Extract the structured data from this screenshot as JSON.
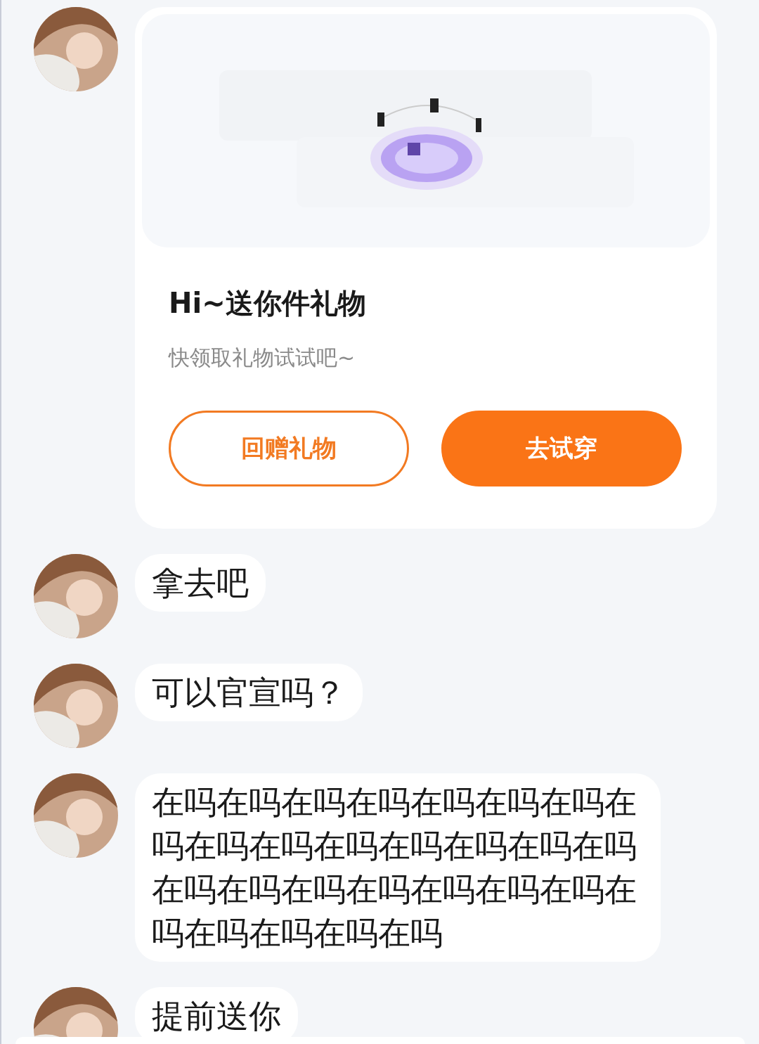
{
  "messages": [
    {
      "kind": "gift",
      "title": "Hi~送你件礼物",
      "subtitle": "快领取礼物试试吧~",
      "buttons": [
        {
          "label": "回赠礼物",
          "kind": "outline"
        },
        {
          "label": "去试穿",
          "kind": "filled"
        }
      ]
    },
    {
      "kind": "text",
      "text": "拿去吧"
    },
    {
      "kind": "text",
      "text": "可以官宣吗？"
    },
    {
      "kind": "text",
      "text": "在吗在吗在吗在吗在吗在吗在吗在吗在吗在吗在吗在吗在吗在吗在吗在吗在吗在吗在吗在吗在吗在吗在吗在吗在吗在吗在吗"
    },
    {
      "kind": "text",
      "text": "提前送你"
    }
  ]
}
